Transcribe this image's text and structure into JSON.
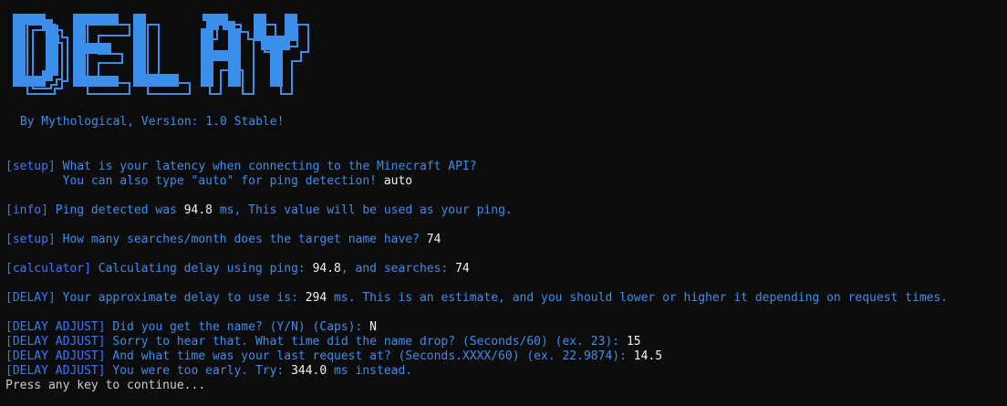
{
  "window": {
    "banner_text": "DELAY",
    "banner_color": "#3b8eea",
    "byline": " By Mythological, Version: 1.0 Stable!"
  },
  "lines": [
    {
      "tag": "[setup]",
      "msg": " What is your latency when connecting to the Minecraft API?",
      "val": ""
    },
    {
      "tag": "",
      "msg": "        You can also type \"auto\" for ping detection! ",
      "val": "auto"
    },
    {
      "tag": "[info]",
      "msg": " Ping detected was ",
      "val": "94.8",
      "msg2": " ms, This value will be used as your ping."
    },
    {
      "tag": "[setup]",
      "msg": " How many searches/month does the target name have? ",
      "val": "74"
    },
    {
      "tag": "[calculator]",
      "msg": " Calculating delay using ping: ",
      "val": "94.8",
      "msg2": ", and searches: ",
      "val2": "74"
    },
    {
      "tag": "[DELAY]",
      "msg": " Your approximate delay to use is: ",
      "val": "294",
      "msg2": " ms. This is an estimate, and you should lower or higher it depending on request times."
    },
    {
      "tag": "[DELAY ADJUST]",
      "msg": " Did you get the name? (Y/N) (Caps): ",
      "val": "N"
    },
    {
      "tag": "[DELAY ADJUST]",
      "msg": " Sorry to hear that. What time did the name drop? (Seconds/60) (ex. 23): ",
      "val": "15"
    },
    {
      "tag": "[DELAY ADJUST]",
      "msg": " And what time was your last request at? (Seconds.XXXX/60) (ex. 22.9874): ",
      "val": "14.5"
    },
    {
      "tag": "[DELAY ADJUST]",
      "msg": " You were too early. Try: ",
      "val": "344.0",
      "msg2": " ms instead."
    }
  ],
  "footer": "Press any key to continue..."
}
